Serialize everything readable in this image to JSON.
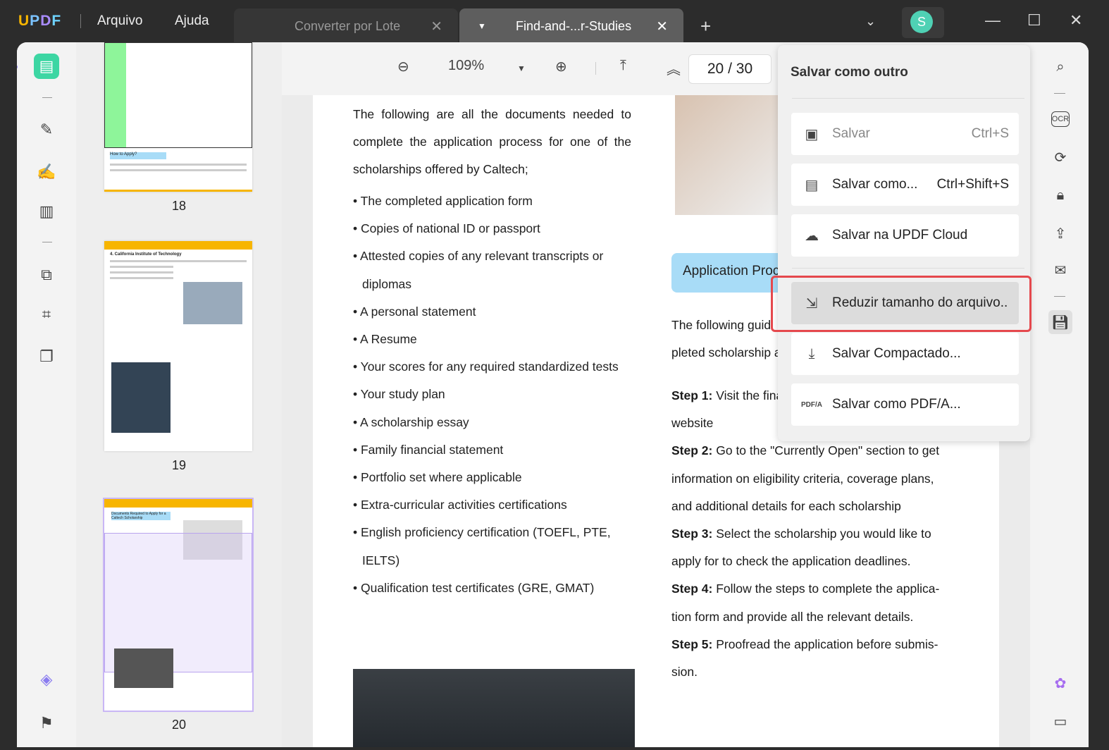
{
  "app": {
    "logo": "UPDF",
    "menu": [
      "Arquivo",
      "Ajuda"
    ],
    "avatar": "S"
  },
  "tabs": [
    {
      "label": "Converter por Lote"
    },
    {
      "label": "Find-and-...r-Studies"
    }
  ],
  "toolbar": {
    "zoom": "109%",
    "page_current": "20",
    "page_sep": "/",
    "page_total": "30"
  },
  "thumbnails": [
    {
      "page": "18",
      "heading": "How to Apply?"
    },
    {
      "page": "19",
      "heading": "4. California Institute of Technology"
    },
    {
      "page": "20",
      "heading": "Documents Required to Apply for a Caltech Scholarship"
    }
  ],
  "document": {
    "intro": "The following are all the documents needed to complete the application process for one of the scholarships offered by Caltech;",
    "list": [
      "• The completed application form",
      "• Copies of national ID or passport",
      "• Attested copies of any relevant transcripts or",
      "diplomas",
      "• A personal statement",
      "• A Resume",
      "• Your scores for any required standardized tests",
      "• Your study plan",
      "• A scholarship essay",
      "• Family financial statement",
      "• Portfolio set where applicable",
      "• Extra-curricular activities certifications",
      "• English proficiency certification (TOEFL, PTE,",
      "IELTS)",
      "• Qualification test certificates (GRE, GMAT)"
    ],
    "section_heading": "Application Proc",
    "guide": [
      "The following guid",
      "pleted scholarship a"
    ],
    "steps": [
      {
        "label": "Step 1:",
        "lines": [
          "Visit the fina",
          "website"
        ]
      },
      {
        "label": "Step 2:",
        "lines": [
          "Go to the \"Currently Open\" section to get",
          "information on eligibility criteria, coverage plans,",
          "and additional details for each scholarship"
        ]
      },
      {
        "label": "Step 3:",
        "lines": [
          "Select the scholarship you would like to",
          "apply for to check the application deadlines."
        ]
      },
      {
        "label": "Step 4:",
        "lines": [
          "Follow the steps to complete the applica-",
          "tion form and provide all the relevant details."
        ]
      },
      {
        "label": "Step 5:",
        "lines": [
          "Proofread the application before submis-",
          "sion."
        ]
      }
    ]
  },
  "popup": {
    "title": "Salvar como outro",
    "items": [
      {
        "label": "Salvar",
        "shortcut": "Ctrl+S",
        "icon": "save-icon"
      },
      {
        "label": "Salvar como...",
        "shortcut": "Ctrl+Shift+S",
        "icon": "save-as-icon"
      },
      {
        "label": "Salvar na UPDF Cloud",
        "icon": "cloud-upload-icon"
      },
      {
        "label": "Reduzir tamanho do arquivo..",
        "icon": "compress-icon"
      },
      {
        "label": "Salvar Compactado...",
        "icon": "download-tray-icon"
      },
      {
        "label": "Salvar como PDF/A...",
        "icon": "pdfa-icon"
      }
    ]
  },
  "colors": {
    "highlight_border": "#e5484d",
    "accent": "#3dd6a3",
    "section_bg": "#a8dcf7"
  }
}
